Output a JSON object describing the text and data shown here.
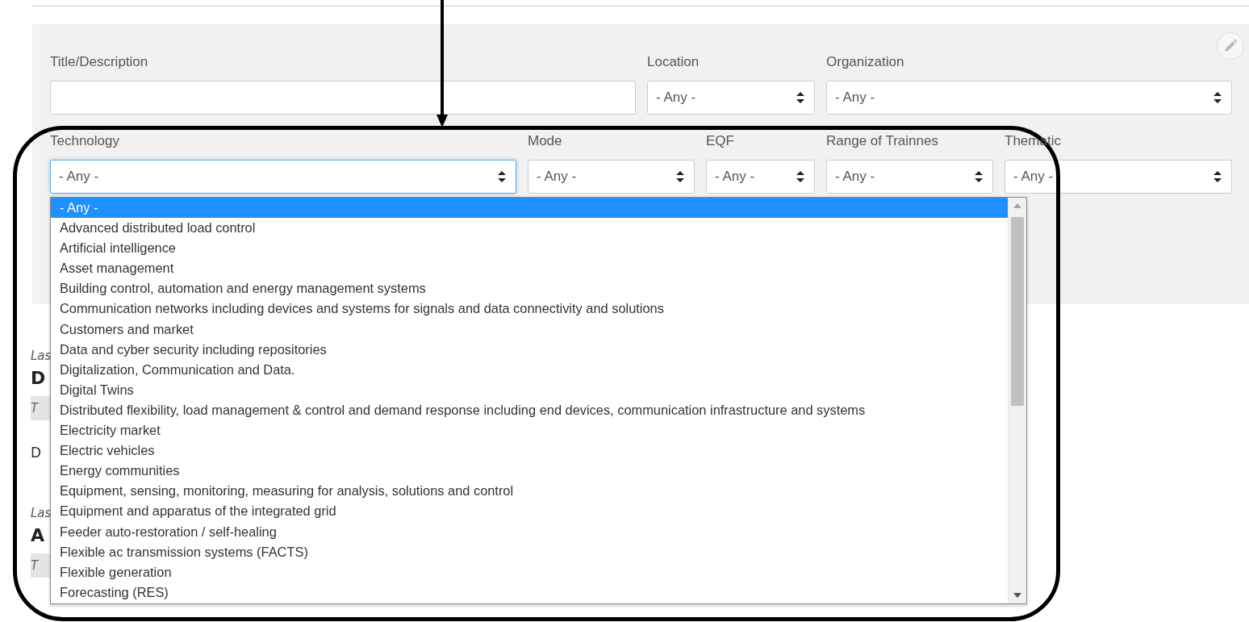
{
  "filter_fields": [
    {
      "label": "Title/Description",
      "kind": "text",
      "focused": false
    },
    {
      "label": "Location",
      "kind": "select",
      "value": "- Any -",
      "focused": false
    },
    {
      "label": "Organization",
      "kind": "select",
      "value": "- Any -",
      "focused": false
    },
    {
      "label": "Technology",
      "kind": "select",
      "value": "- Any -",
      "focused": true
    },
    {
      "label": "Mode",
      "kind": "select",
      "value": "- Any -",
      "focused": false
    },
    {
      "label": "EQF",
      "kind": "select",
      "value": "- Any -",
      "focused": false
    },
    {
      "label": "Range of Trainnes",
      "kind": "select",
      "value": "- Any -",
      "focused": false
    },
    {
      "label": "Thematic",
      "kind": "select",
      "value": "- Any -",
      "focused": false
    }
  ],
  "dropdown": {
    "options": [
      {
        "label": "- Any -",
        "selected": true
      },
      {
        "label": "Advanced distributed load control",
        "selected": false
      },
      {
        "label": "Artificial intelligence",
        "selected": false
      },
      {
        "label": "Asset management",
        "selected": false
      },
      {
        "label": "Building control, automation and energy management systems",
        "selected": false
      },
      {
        "label": "Communication networks including devices and systems for signals and data connectivity and solutions",
        "selected": false
      },
      {
        "label": "Customers and market",
        "selected": false
      },
      {
        "label": "Data and cyber security including repositories",
        "selected": false
      },
      {
        "label": "Digitalization, Communication and Data.",
        "selected": false
      },
      {
        "label": "Digital Twins",
        "selected": false
      },
      {
        "label": "Distributed flexibility, load management & control and demand response including end devices, communication infrastructure and systems",
        "selected": false
      },
      {
        "label": "Electricity market",
        "selected": false
      },
      {
        "label": "Electric vehicles",
        "selected": false
      },
      {
        "label": "Energy communities",
        "selected": false
      },
      {
        "label": "Equipment, sensing, monitoring, measuring for analysis, solutions and control",
        "selected": false
      },
      {
        "label": "Equipment and apparatus of the integrated grid",
        "selected": false
      },
      {
        "label": "Feeder auto-restoration / self-healing",
        "selected": false
      },
      {
        "label": "Flexible ac transmission systems (FACTS)",
        "selected": false
      },
      {
        "label": "Flexible generation",
        "selected": false
      },
      {
        "label": "Forecasting (RES)",
        "selected": false
      }
    ]
  },
  "results": [
    {
      "kind": "meta",
      "text": "Las"
    },
    {
      "kind": "title",
      "text": "D"
    },
    {
      "kind": "tag",
      "text": "T"
    },
    {
      "kind": "body",
      "text": "D"
    },
    {
      "kind": "meta",
      "text": "Las"
    },
    {
      "kind": "title",
      "text": "A"
    },
    {
      "kind": "tag",
      "text": "T"
    }
  ]
}
